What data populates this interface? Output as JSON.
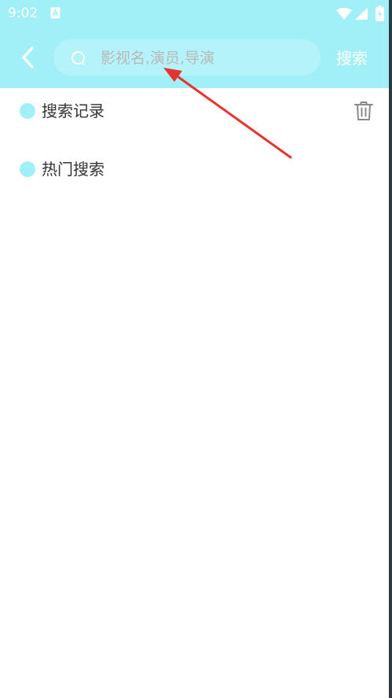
{
  "status_bar": {
    "time": "9:02",
    "icons": [
      "notification-a-icon",
      "wifi-icon",
      "signal-icon",
      "battery-charging-icon"
    ]
  },
  "header": {
    "back_icon": "chevron-left-icon",
    "search": {
      "placeholder": "影视名,演员,导演",
      "value": "",
      "icon": "search-icon"
    },
    "search_button_label": "搜索"
  },
  "sections": {
    "history": {
      "label": "搜索记录",
      "clear_icon": "trash-icon"
    },
    "hot": {
      "label": "热门搜索"
    }
  },
  "colors": {
    "header_bg": "#a2f0f7",
    "search_bg": "#b4f3f9",
    "accent_dot": "#a2f0f7",
    "annotation_arrow": "#e8342e"
  }
}
